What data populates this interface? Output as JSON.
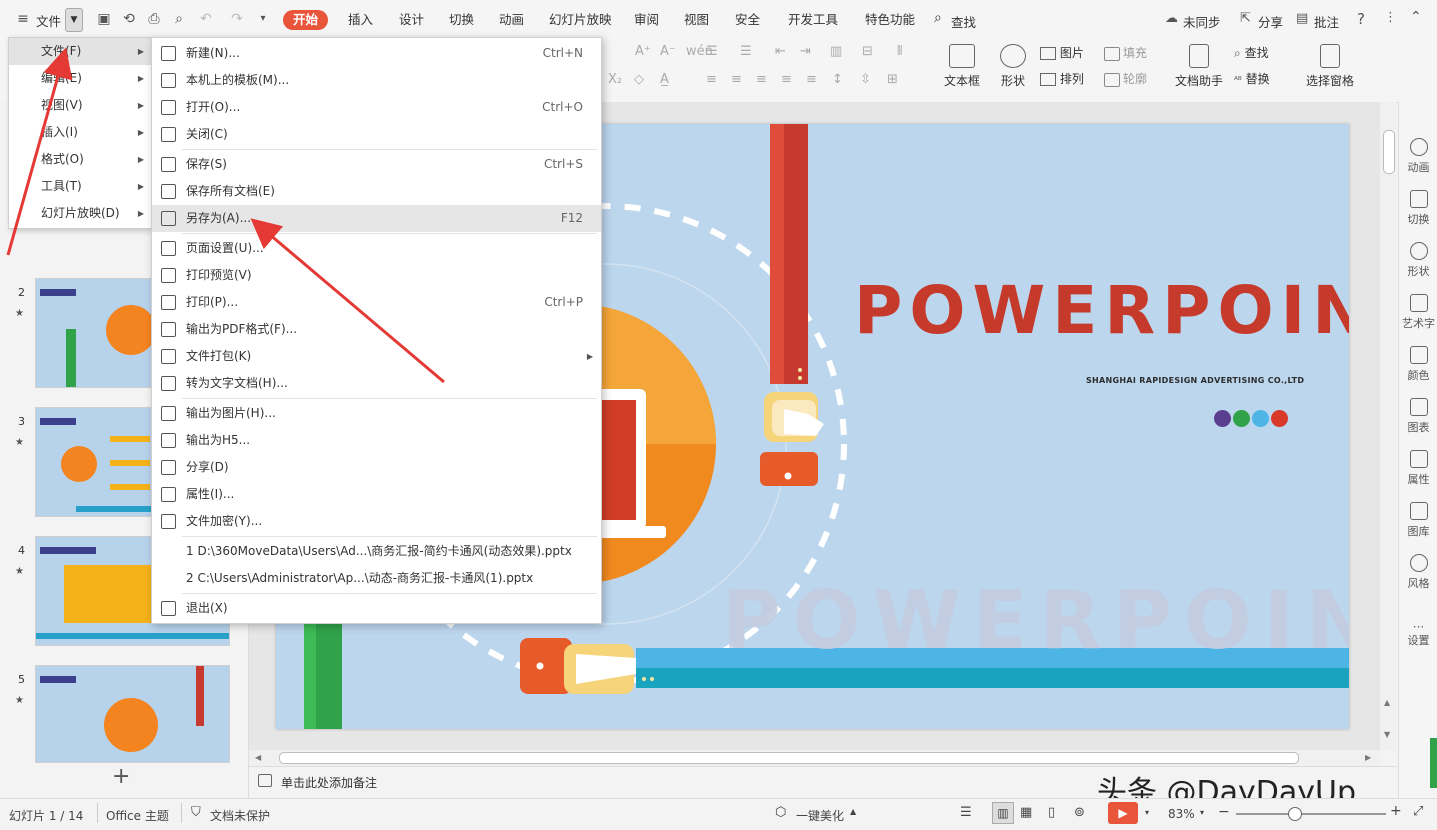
{
  "tabbar": {
    "menu_label": "文件",
    "tabs": [
      "开始",
      "插入",
      "设计",
      "切换",
      "动画",
      "幻灯片放映",
      "审阅",
      "视图",
      "安全",
      "开发工具",
      "特色功能"
    ],
    "search_label": "查找",
    "sync_label": "未同步",
    "share_label": "分享",
    "comment_label": "批注",
    "help_label": "?"
  },
  "ribbon": {
    "textbox_label": "文本框",
    "shape_label": "形状",
    "picture_label": "图片",
    "fill_label": "填充",
    "arrange_label": "排列",
    "outline_label": "轮廓",
    "doc_assistant_label": "文档助手",
    "find_label": "查找",
    "replace_label": "替换",
    "select_pane_label": "选择窗格"
  },
  "menu_main": {
    "items": [
      {
        "label": "文件(F)",
        "active": true
      },
      {
        "label": "编辑(E)"
      },
      {
        "label": "视图(V)"
      },
      {
        "label": "插入(I)"
      },
      {
        "label": "格式(O)"
      },
      {
        "label": "工具(T)"
      },
      {
        "label": "幻灯片放映(D)"
      }
    ]
  },
  "menu_file": {
    "groups": [
      [
        {
          "label": "新建(N)...",
          "shortcut": "Ctrl+N"
        },
        {
          "label": "本机上的模板(M)...",
          "shortcut": ""
        },
        {
          "label": "打开(O)...",
          "shortcut": "Ctrl+O"
        },
        {
          "label": "关闭(C)",
          "shortcut": ""
        }
      ],
      [
        {
          "label": "保存(S)",
          "shortcut": "Ctrl+S"
        },
        {
          "label": "保存所有文档(E)",
          "shortcut": ""
        },
        {
          "label": "另存为(A)...",
          "shortcut": "F12",
          "active": true
        }
      ],
      [
        {
          "label": "页面设置(U)...",
          "shortcut": ""
        },
        {
          "label": "打印预览(V)",
          "shortcut": ""
        },
        {
          "label": "打印(P)...",
          "shortcut": "Ctrl+P"
        },
        {
          "label": "输出为PDF格式(F)...",
          "shortcut": ""
        },
        {
          "label": "文件打包(K)",
          "shortcut": "",
          "submenu": true
        },
        {
          "label": "转为文字文档(H)...",
          "shortcut": ""
        }
      ],
      [
        {
          "label": "输出为图片(H)...",
          "shortcut": ""
        },
        {
          "label": "输出为H5...",
          "shortcut": ""
        },
        {
          "label": "分享(D)",
          "shortcut": ""
        },
        {
          "label": "属性(I)...",
          "shortcut": ""
        },
        {
          "label": "文件加密(Y)...",
          "shortcut": ""
        }
      ],
      [
        {
          "label": "1 D:\\360MoveData\\Users\\Ad...\\商务汇报-简约卡通风(动态效果).pptx",
          "shortcut": ""
        },
        {
          "label": "2 C:\\Users\\Administrator\\Ap...\\动态-商务汇报-卡通风(1).pptx",
          "shortcut": ""
        }
      ],
      [
        {
          "label": "退出(X)",
          "shortcut": ""
        }
      ]
    ]
  },
  "thumbs": {
    "numbers": [
      "2",
      "3",
      "4",
      "5"
    ]
  },
  "slide": {
    "title": "POWERPOINT",
    "subtitle": "SHANGHAI RAPIDESIGN ADVERTISING CO.,LTD",
    "watermark": "POWERPOINT",
    "dot_colors": [
      "#5b3f8f",
      "#2fa24a",
      "#4db4e6",
      "#d9392b"
    ]
  },
  "right_sidebar": [
    "动画",
    "切换",
    "形状",
    "艺术字",
    "颜色",
    "图表",
    "属性",
    "图库",
    "风格",
    "设置"
  ],
  "notes": {
    "placeholder": "单击此处添加备注"
  },
  "status": {
    "slide_info": "幻灯片 1 / 14",
    "theme": "Office 主题",
    "protect": "文档未保护",
    "beautify": "一键美化",
    "zoom": "83%"
  },
  "watermark_text": "头条 @DayDayUp"
}
